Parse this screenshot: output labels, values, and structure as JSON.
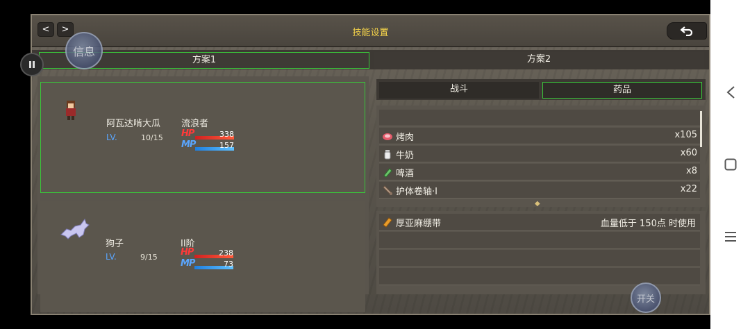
{
  "title": "技能设置",
  "nav": {
    "prev": "<",
    "next": ">"
  },
  "info_bubble": "信息",
  "plans": [
    "方案1",
    "方案2"
  ],
  "members": [
    {
      "name": "阿瓦达啃大瓜",
      "class": "流浪者",
      "lv_label": "LV.",
      "lv": "10/15",
      "hp_label": "HP",
      "hp": "338",
      "hp_fill": 1.0,
      "mp_label": "MP",
      "mp": "157",
      "mp_fill": 1.0
    },
    {
      "name": "狗子",
      "class": "II阶",
      "lv_label": "LV.",
      "lv": "9/15",
      "hp_label": "HP",
      "hp": "238",
      "hp_fill": 1.0,
      "mp_label": "MP",
      "mp": "73",
      "mp_fill": 1.0
    }
  ],
  "categories": [
    "战斗",
    "药品"
  ],
  "items": [
    {
      "name": "烤肉",
      "qty": "x105",
      "icon": "meat-icon"
    },
    {
      "name": "牛奶",
      "qty": "x60",
      "icon": "milk-icon"
    },
    {
      "name": "啤酒",
      "qty": "x8",
      "icon": "beer-icon"
    },
    {
      "name": "护体卷轴·I",
      "qty": "x22",
      "icon": "scroll-icon"
    }
  ],
  "rules": [
    {
      "name": "厚亚麻绷带",
      "condition": "血量低于 150点 时使用",
      "icon": "bandage-icon"
    }
  ],
  "open_bubble": "开关",
  "colors": {
    "accent_green": "#3ac63a",
    "title_yellow": "#f3d24a",
    "hp_red": "#ff3a3a",
    "mp_blue": "#5aa6ff"
  }
}
